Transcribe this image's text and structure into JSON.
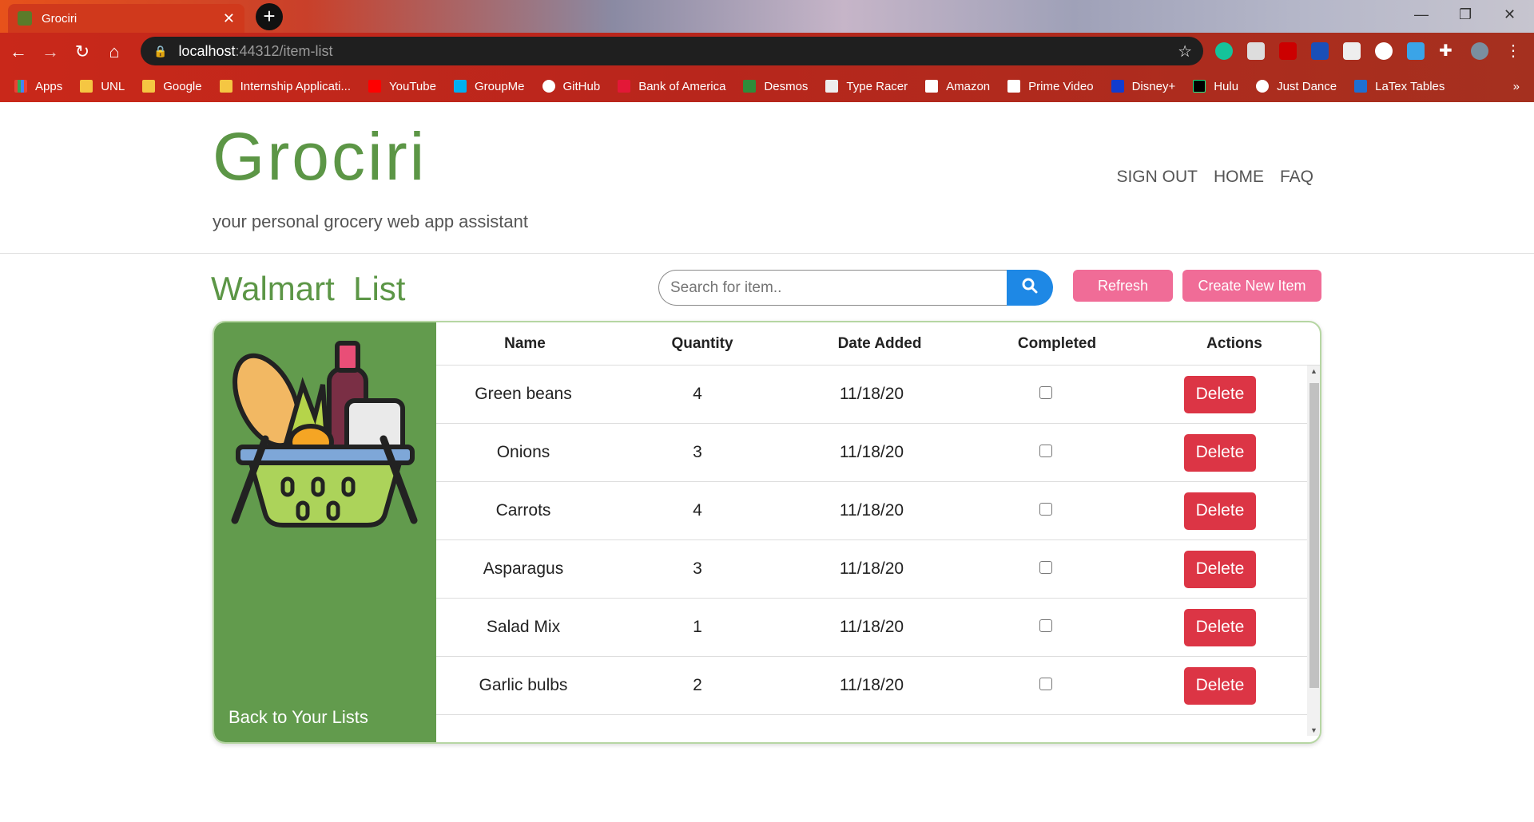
{
  "browser": {
    "tab_title": "Grociri",
    "url_host": "localhost",
    "url_path": ":44312/item-list",
    "bookmarks": [
      "Apps",
      "UNL",
      "Google",
      "Internship Applicati...",
      "YouTube",
      "GroupMe",
      "GitHub",
      "Bank of America",
      "Desmos",
      "Type Racer",
      "Amazon",
      "Prime Video",
      "Disney+",
      "Hulu",
      "Just Dance",
      "LaTex Tables"
    ],
    "more": "»"
  },
  "header": {
    "brand": "Grociri",
    "tagline": "your personal grocery web app assistant",
    "nav": [
      "SIGN OUT",
      "HOME",
      "FAQ"
    ]
  },
  "list": {
    "title": "Walmart  List",
    "search_placeholder": "Search for item..",
    "refresh_label": "Refresh",
    "create_label": "Create New Item",
    "back_label": "Back to Your Lists",
    "columns": [
      "Name",
      "Quantity",
      "Date Added",
      "Completed",
      "Actions"
    ],
    "delete_label": "Delete",
    "items": [
      {
        "name": "Green beans",
        "quantity": "4",
        "date": "11/18/20"
      },
      {
        "name": "Onions",
        "quantity": "3",
        "date": "11/18/20"
      },
      {
        "name": "Carrots",
        "quantity": "4",
        "date": "11/18/20"
      },
      {
        "name": "Asparagus",
        "quantity": "3",
        "date": "11/18/20"
      },
      {
        "name": "Salad Mix",
        "quantity": "1",
        "date": "11/18/20"
      },
      {
        "name": "Garlic bulbs",
        "quantity": "2",
        "date": "11/18/20"
      }
    ]
  }
}
